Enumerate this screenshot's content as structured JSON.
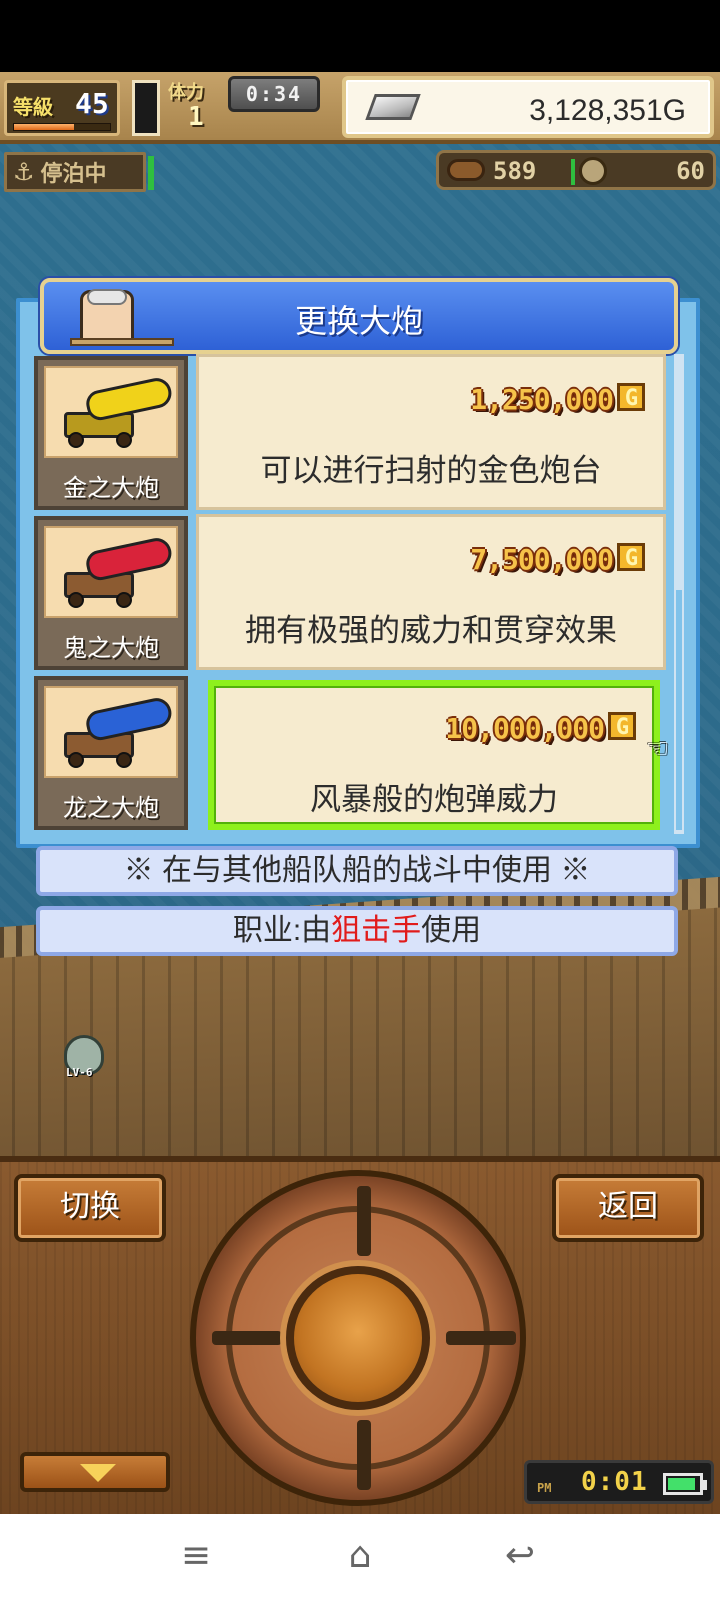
{
  "hud": {
    "level_label": "等級",
    "level": "45",
    "exp_progress": 0.62,
    "stamina_label": "体力",
    "stamina": "1",
    "timer": "0:34",
    "money": "3,128,351G",
    "anchor_status": "停泊中",
    "wood": "589",
    "coins": "60"
  },
  "dialog": {
    "title": "更换大炮",
    "items": [
      {
        "name": "金之大炮",
        "price": "1,250,000",
        "currency": "G",
        "description": "可以进行扫射的金色炮台",
        "color": "#f0d21a"
      },
      {
        "name": "鬼之大炮",
        "price": "7,500,000",
        "currency": "G",
        "description": "拥有极强的威力和贯穿效果",
        "color": "#d9233a"
      },
      {
        "name": "龙之大炮",
        "price": "10,000,000",
        "currency": "G",
        "description": "风暴般的炮弹威力",
        "color": "#2a62d6"
      }
    ],
    "selected_index": 2,
    "note": "※ 在与其他船队船的战斗中使用 ※",
    "job_prefix": "职业:由",
    "job_class": "狙击手",
    "job_suffix": "使用"
  },
  "controls": {
    "switch_label": "切换",
    "back_label": "返回",
    "down_icon": "triangle-down-icon"
  },
  "clock": {
    "ampm": "PM",
    "time": "0:01",
    "battery_level": 0.9
  },
  "navbar": {
    "menu_icon": "≡",
    "home_icon": "⌂",
    "back_icon": "↩"
  },
  "colors": {
    "selection": "#8ef01d",
    "job_highlight": "#e11b1b",
    "dialog_header": "#2e61d6"
  }
}
